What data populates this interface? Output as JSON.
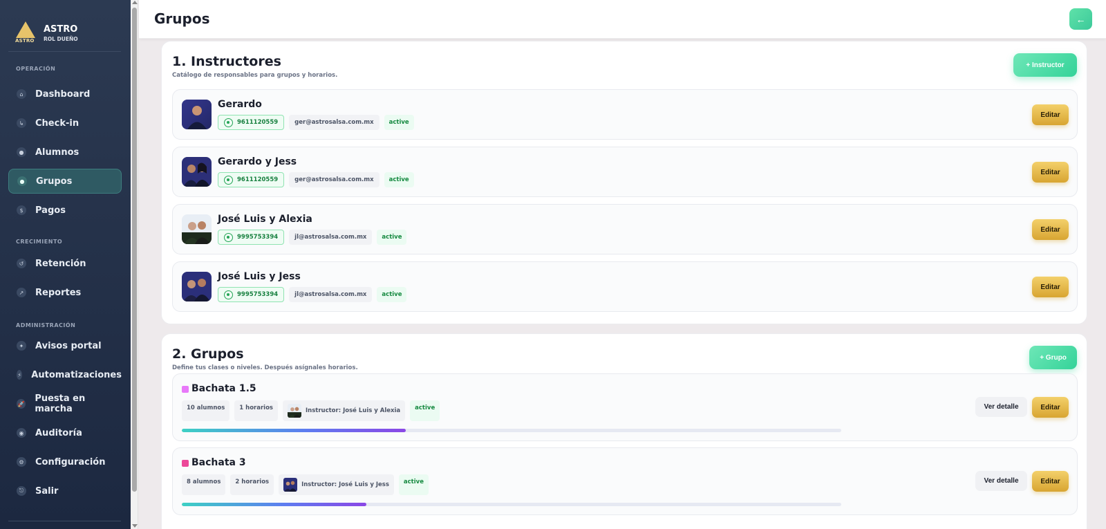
{
  "brand": {
    "logo_text": "ASTRO",
    "name": "ASTRO",
    "role": "ROL DUEÑO"
  },
  "sidebar": {
    "sections": [
      {
        "label": "OPERACIÓN"
      },
      {
        "label": "CRECIMIENTO"
      },
      {
        "label": "ADMINISTRACIÓN"
      }
    ],
    "items": [
      {
        "label": "Dashboard",
        "icon": "home-icon",
        "glyph": "⌂",
        "active": false
      },
      {
        "label": "Check-in",
        "icon": "checkin-icon",
        "glyph": "↳",
        "active": false
      },
      {
        "label": "Alumnos",
        "icon": "students-icon",
        "glyph": "●",
        "active": false
      },
      {
        "label": "Grupos",
        "icon": "groups-icon",
        "glyph": "●",
        "active": true
      },
      {
        "label": "Pagos",
        "icon": "payments-icon",
        "glyph": "$",
        "active": false
      },
      {
        "label": "Retención",
        "icon": "retention-icon",
        "glyph": "↺",
        "active": false
      },
      {
        "label": "Reportes",
        "icon": "reports-icon",
        "glyph": "↗",
        "active": false
      },
      {
        "label": "Avisos portal",
        "icon": "announcements-icon",
        "glyph": "✦",
        "active": false
      },
      {
        "label": "Automatizaciones",
        "icon": "automation-icon",
        "glyph": "⚡",
        "active": false
      },
      {
        "label": "Puesta en marcha",
        "icon": "rocket-icon",
        "glyph": "🚀",
        "active": false
      },
      {
        "label": "Auditoría",
        "icon": "audit-icon",
        "glyph": "◉",
        "active": false
      },
      {
        "label": "Configuración",
        "icon": "gear-icon",
        "glyph": "⚙",
        "active": false
      },
      {
        "label": "Salir",
        "icon": "logout-icon",
        "glyph": "⎋",
        "active": false
      }
    ]
  },
  "header": {
    "title": "Grupos",
    "back_label": "←"
  },
  "instructors_section": {
    "title": "1. Instructores",
    "subtitle": "Catálogo de responsables para grupos y horarios.",
    "add_label": "+ Instructor",
    "edit_label": "Editar",
    "items": [
      {
        "name": "Gerardo",
        "phone": "9611120559",
        "email": "ger@astrosalsa.com.mx",
        "status": "active"
      },
      {
        "name": "Gerardo y Jess",
        "phone": "9611120559",
        "email": "ger@astrosalsa.com.mx",
        "status": "active"
      },
      {
        "name": "José Luis y Alexia",
        "phone": "9995753394",
        "email": "jl@astrosalsa.com.mx",
        "status": "active"
      },
      {
        "name": "José Luis y Jess",
        "phone": "9995753394",
        "email": "jl@astrosalsa.com.mx",
        "status": "active"
      }
    ]
  },
  "groups_section": {
    "title": "2. Grupos",
    "subtitle": "Define tus clases o niveles. Después asígnales horarios.",
    "add_label": "+ Grupo",
    "detail_label": "Ver detalle",
    "edit_label": "Editar",
    "items": [
      {
        "name": "Bachata 1.5",
        "color": "#e879f9",
        "students": "10 alumnos",
        "schedules": "1 horarios",
        "instructor": "Instructor: José Luis y Alexia",
        "status": "active",
        "progress": 0.34
      },
      {
        "name": "Bachata 3",
        "color": "#ec4899",
        "students": "8 alumnos",
        "schedules": "2 horarios",
        "instructor": "Instructor: José Luis y Jess",
        "status": "active",
        "progress": 0.28
      }
    ]
  },
  "colors": {
    "accent_green": "#34d399",
    "accent_gold": "#d8a532",
    "sidebar_bg": "#1c2840"
  }
}
